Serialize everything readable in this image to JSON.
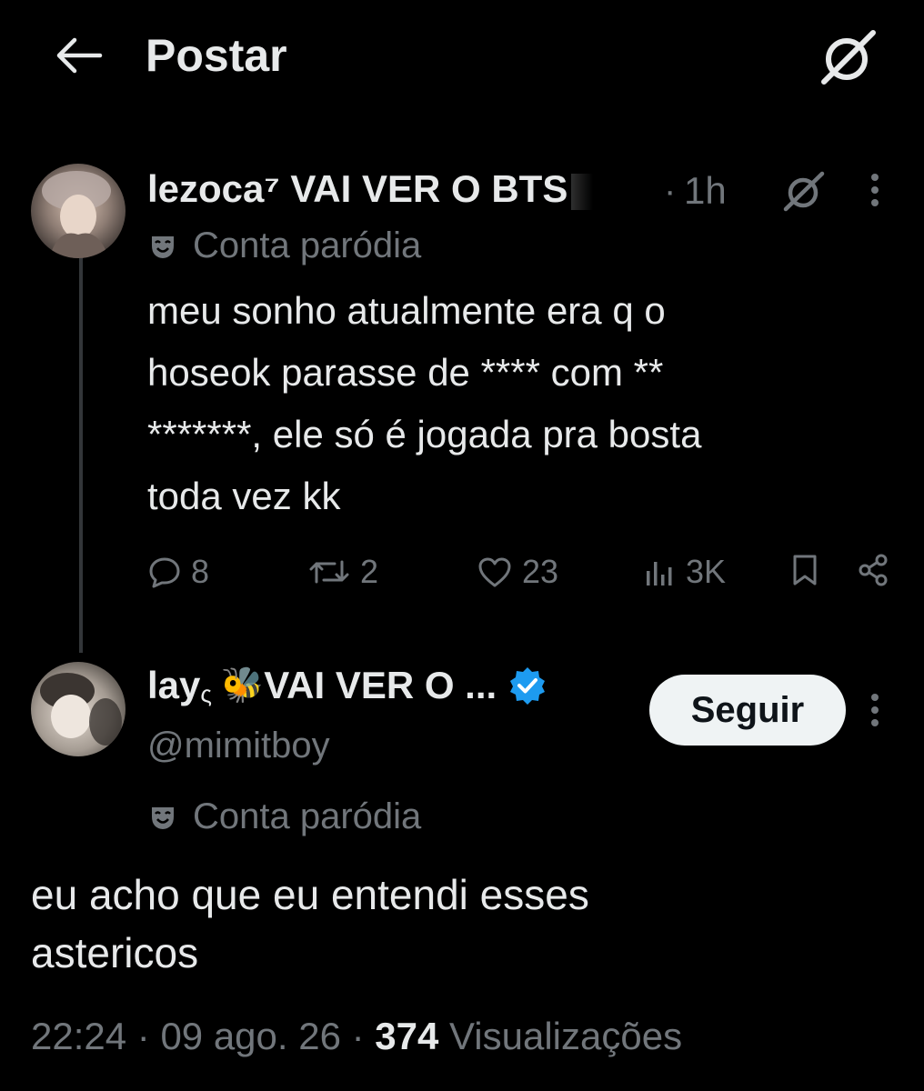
{
  "header": {
    "title": "Postar",
    "back_icon": "arrow-left-icon",
    "grok_icon": "grok-icon"
  },
  "tweet1": {
    "name": "lezoca⁷ VAI VER O BTS",
    "time": "1h",
    "separator": "·",
    "parody_label": "Conta paródia",
    "text": "meu sonho atualmente era q o\nhoseok parasse de **** com **\n*******, ele só é jogada pra bosta\ntoda vez kk",
    "actions": {
      "replies": "8",
      "reposts": "2",
      "likes": "23",
      "views": "3K"
    }
  },
  "tweet2": {
    "name_prefix": "lay",
    "name_sub": "ς",
    "name_emoji": "🐝",
    "name_rest": " VAI VER O ...",
    "handle": "@mimitboy",
    "follow_label": "Seguir",
    "parody_label": "Conta paródia",
    "text": "eu acho que eu entendi esses\nastericos",
    "meta": {
      "time": "22:24",
      "sep1": " · ",
      "date": "09 ago. 26",
      "sep2": " · ",
      "views": "374",
      "views_label": " Visualizações"
    }
  },
  "colors": {
    "background": "#000000",
    "text": "#e7e9ea",
    "muted": "#71767b",
    "verified": "#1d9bf0",
    "follow_bg": "#eff3f4"
  }
}
